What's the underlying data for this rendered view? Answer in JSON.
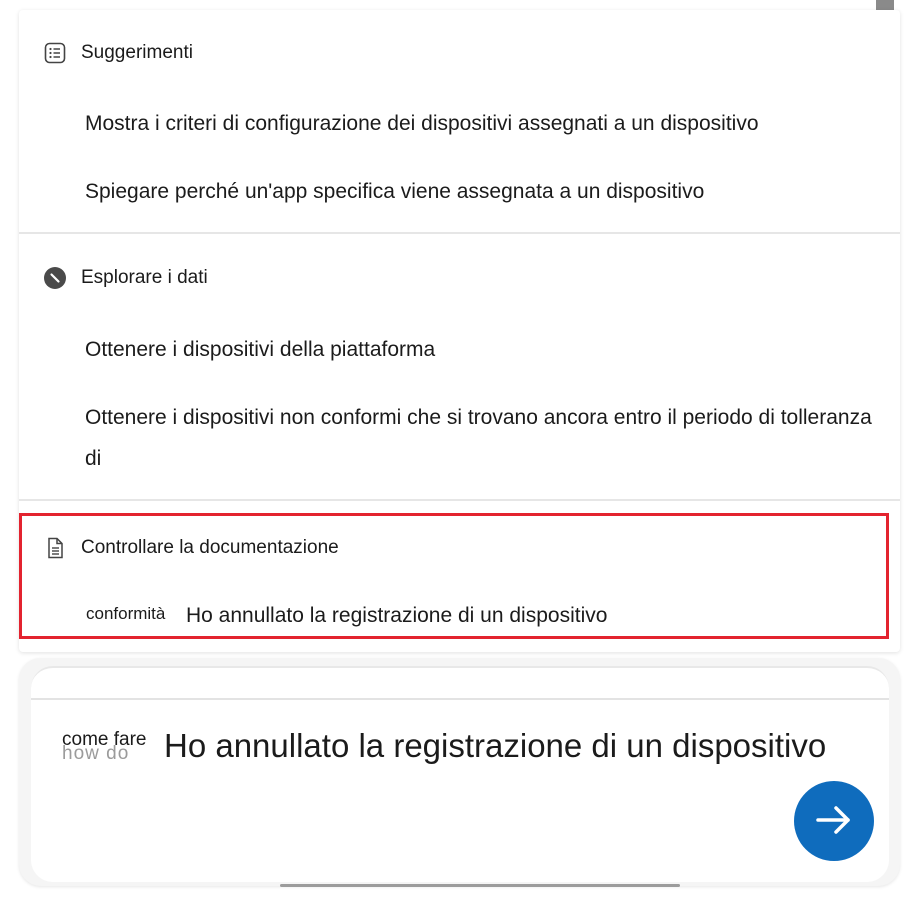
{
  "suggestions": {
    "heading": "Suggerimenti",
    "items": [
      "Mostra i criteri di configurazione dei dispositivi assegnati a un dispositivo",
      "Spiegare perché un'app specifica viene assegnata a un dispositivo"
    ]
  },
  "explore": {
    "heading": "Esplorare i dati",
    "items": [
      "Ottenere i dispositivi della piattaforma",
      "Ottenere i dispositivi non conformi che si trovano ancora entro il periodo di tolleranza di"
    ]
  },
  "documentation": {
    "heading": "Controllare la documentazione",
    "tag": "conformità",
    "item": "Ho annullato la registrazione di un dispositivo"
  },
  "composer": {
    "prefix": "come fare",
    "prefix_ghost": "how do",
    "query": "Ho annullato la registrazione di un dispositivo",
    "send_icon": "arrow-right-icon"
  },
  "colors": {
    "accent": "#0f6cbd",
    "highlight": "#e3232f"
  }
}
